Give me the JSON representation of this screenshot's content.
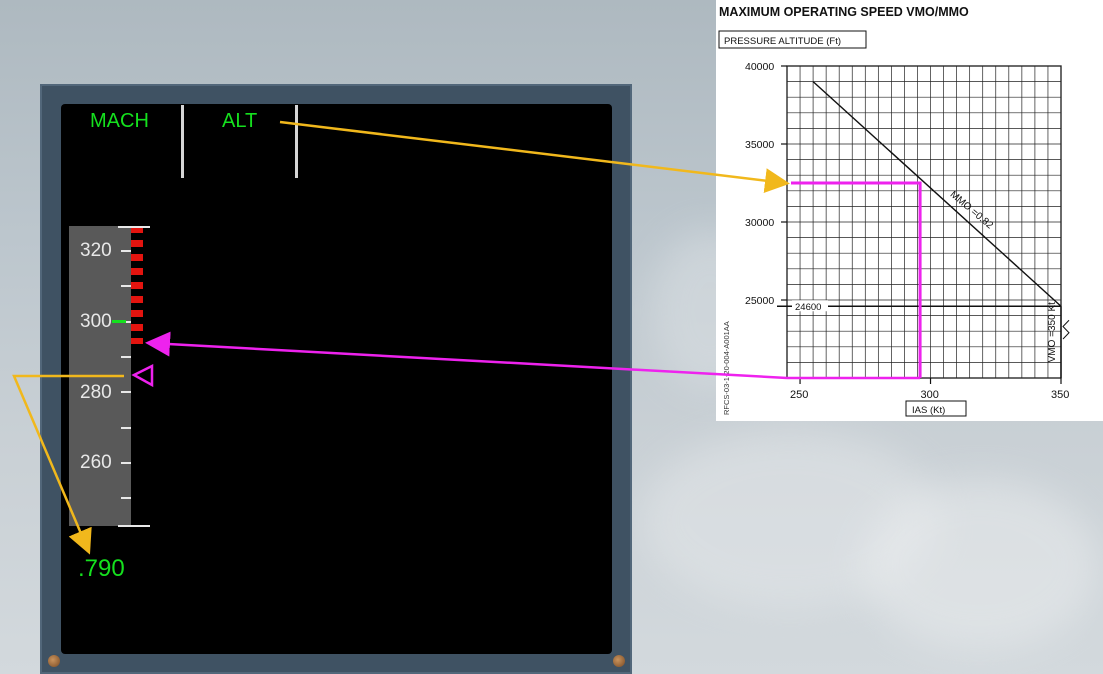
{
  "pfd": {
    "fma": {
      "mach_label": "MACH",
      "alt_label": "ALT"
    },
    "speed_tape": {
      "labels": [
        "320",
        "300",
        "280",
        "260"
      ],
      "current_speed_kt": 285
    },
    "mach_readout": ".790"
  },
  "chart_data": {
    "type": "line",
    "title": "MAXIMUM OPERATING SPEED VMO/MMO",
    "ylabel": "PRESSURE ALTITUDE (Ft)",
    "xlabel": "IAS (Kt)",
    "xlim": [
      245,
      350
    ],
    "ylim": [
      20000,
      40000
    ],
    "x_ticks": [
      "250",
      "300",
      "350"
    ],
    "y_ticks": [
      "25000",
      "30000",
      "35000",
      "40000"
    ],
    "grid": true,
    "series": [
      {
        "name": "MMO =0.82",
        "points": [
          [
            255,
            39000
          ],
          [
            350,
            24600
          ]
        ]
      },
      {
        "name": "VMO =350 Kt",
        "points": [
          [
            350,
            24600
          ],
          [
            350,
            20000
          ]
        ]
      }
    ],
    "reference_line": {
      "label": "24600",
      "y": 24600
    },
    "side_code": "RFCS-03-1-20-004-A001AA",
    "readout": {
      "altitude_ft": 32500,
      "ias_kt": 296
    }
  },
  "colors": {
    "annotation_yellow": "#f1b81c",
    "annotation_magenta": "#ee22ee",
    "pfd_green": "#15e01e",
    "overspeed_red": "#e3140f"
  }
}
